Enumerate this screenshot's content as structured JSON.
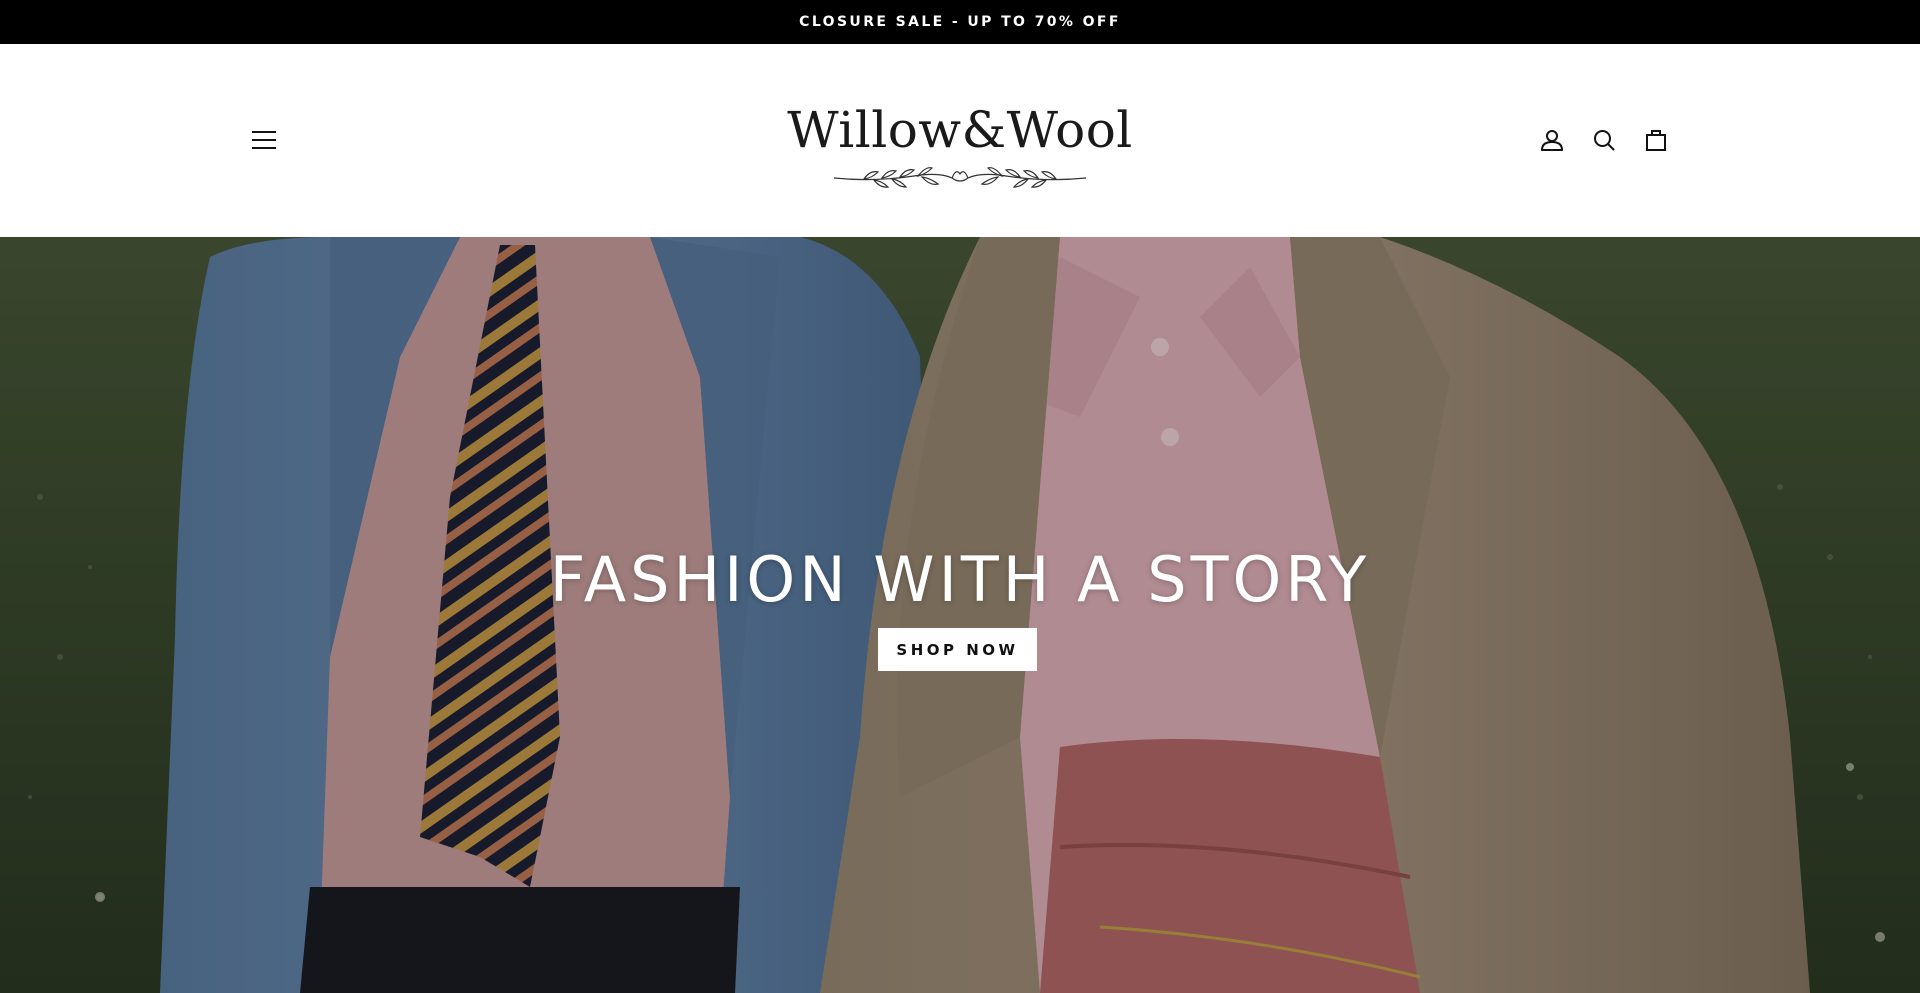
{
  "announcement": {
    "text": "CLOSURE SALE - UP TO 70% OFF"
  },
  "header": {
    "logo_text": "Willow&Wool",
    "icons": {
      "menu": "hamburger-menu-icon",
      "account": "user-account-icon",
      "search": "search-icon",
      "cart": "shopping-bag-icon"
    }
  },
  "hero": {
    "title": "FASHION WITH A STORY",
    "button_label": "SHOP NOW"
  },
  "colors": {
    "announcement_bg": "#000000",
    "announcement_text": "#ffffff",
    "header_bg": "#ffffff",
    "button_bg": "#ffffff",
    "hero_text": "#ffffff"
  }
}
